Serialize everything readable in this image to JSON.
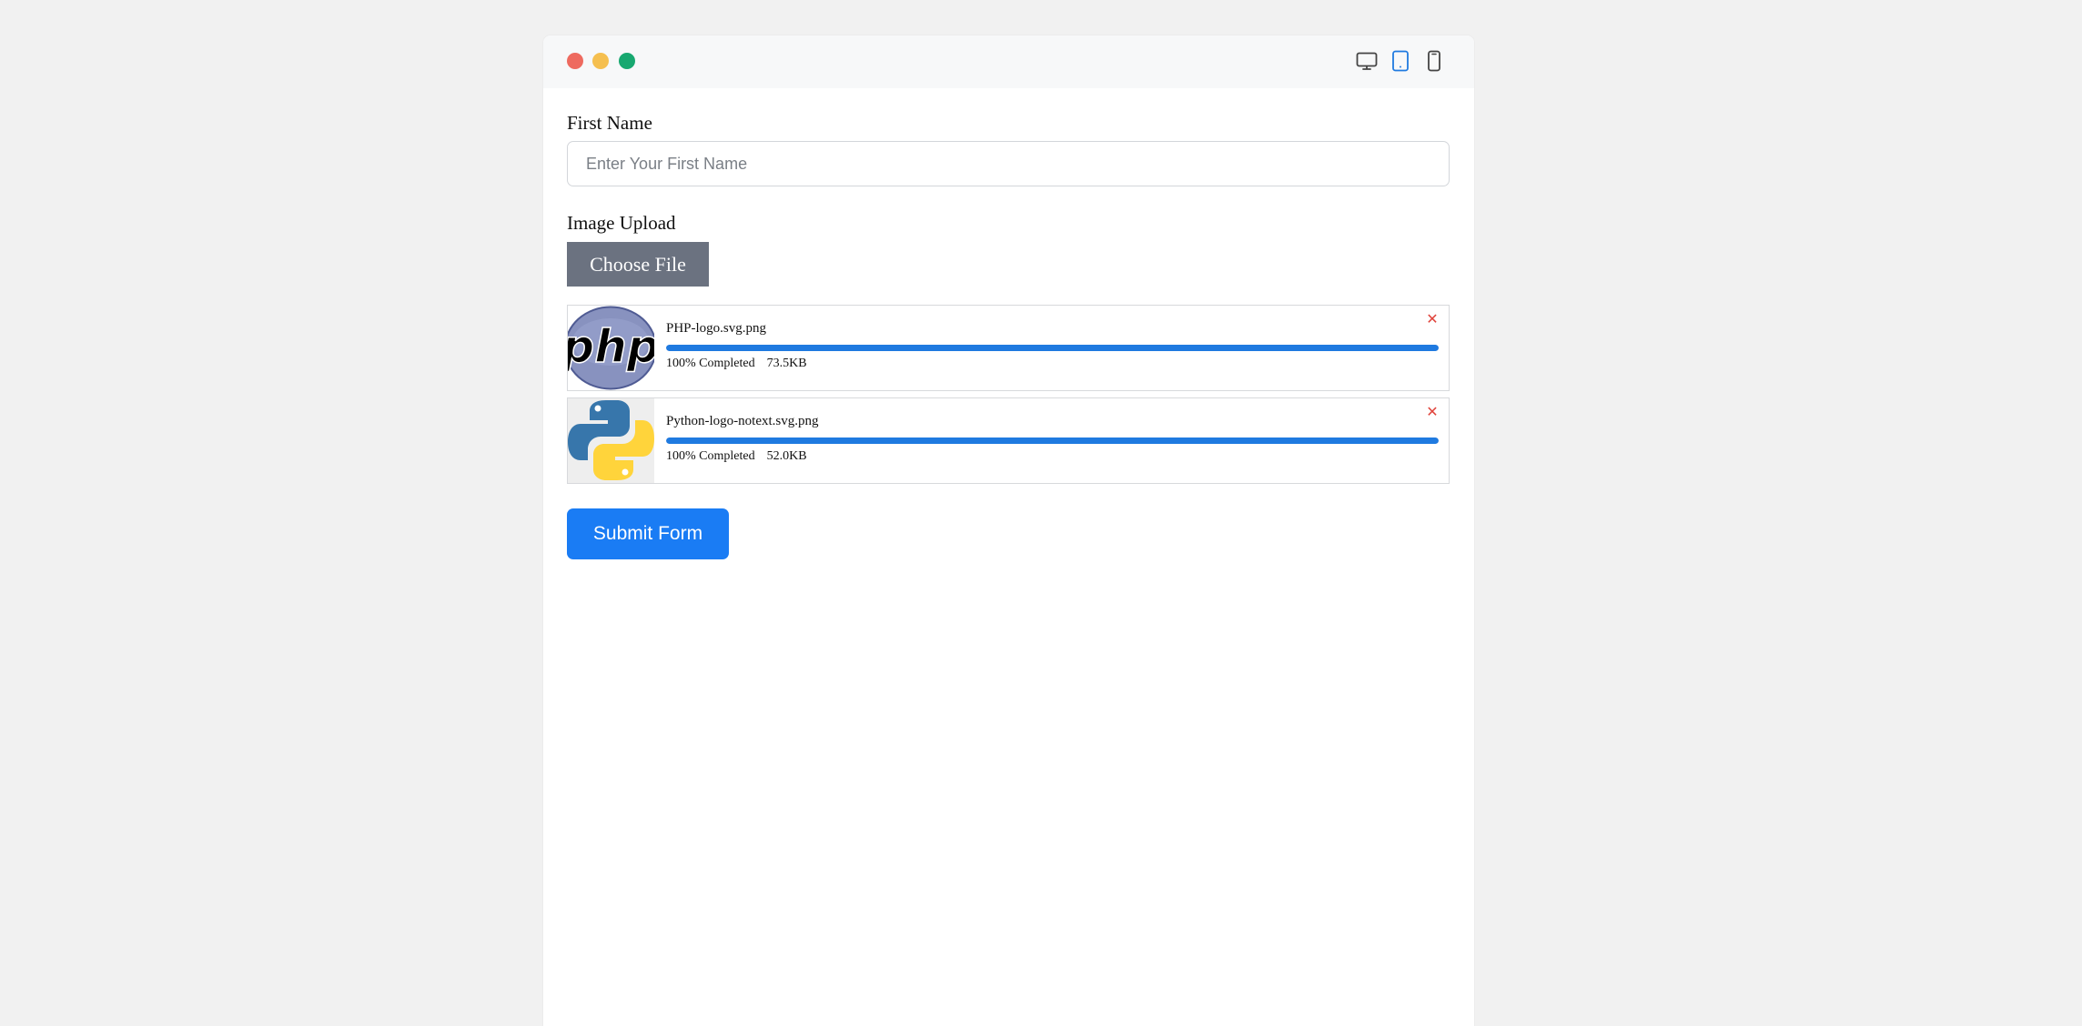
{
  "window": {
    "controls": [
      {
        "name": "close",
        "color": "#ee6a5f"
      },
      {
        "name": "minimize",
        "color": "#f5bf4f"
      },
      {
        "name": "maximize",
        "color": "#17a870"
      }
    ],
    "device_toggles": [
      {
        "icon": "desktop-icon",
        "active": false
      },
      {
        "icon": "tablet-icon",
        "active": true
      },
      {
        "icon": "mobile-icon",
        "active": false
      }
    ]
  },
  "form": {
    "first_name": {
      "label": "First Name",
      "placeholder": "Enter Your First Name",
      "value": ""
    },
    "image_upload": {
      "label": "Image Upload",
      "choose_label": "Choose File"
    },
    "files": [
      {
        "name": "PHP-logo.svg.png",
        "progress": 1.0,
        "status": "100% Completed",
        "size": "73.5KB",
        "thumbnail_icon": "php-logo-icon",
        "remove_icon": "close-icon",
        "remove_glyph": "✕"
      },
      {
        "name": "Python-logo-notext.svg.png",
        "progress": 1.0,
        "status": "100% Completed",
        "size": "52.0KB",
        "thumbnail_icon": "python-logo-icon",
        "remove_icon": "close-icon",
        "remove_glyph": "✕"
      }
    ],
    "submit_label": "Submit Form"
  },
  "colors": {
    "accent": "#1a7cf4",
    "progress": "#1f7ae0",
    "choose_button": "#6b7280",
    "remove": "#e0443c",
    "active_toggle": "#1f7ae0",
    "inactive_toggle": "#444444"
  }
}
